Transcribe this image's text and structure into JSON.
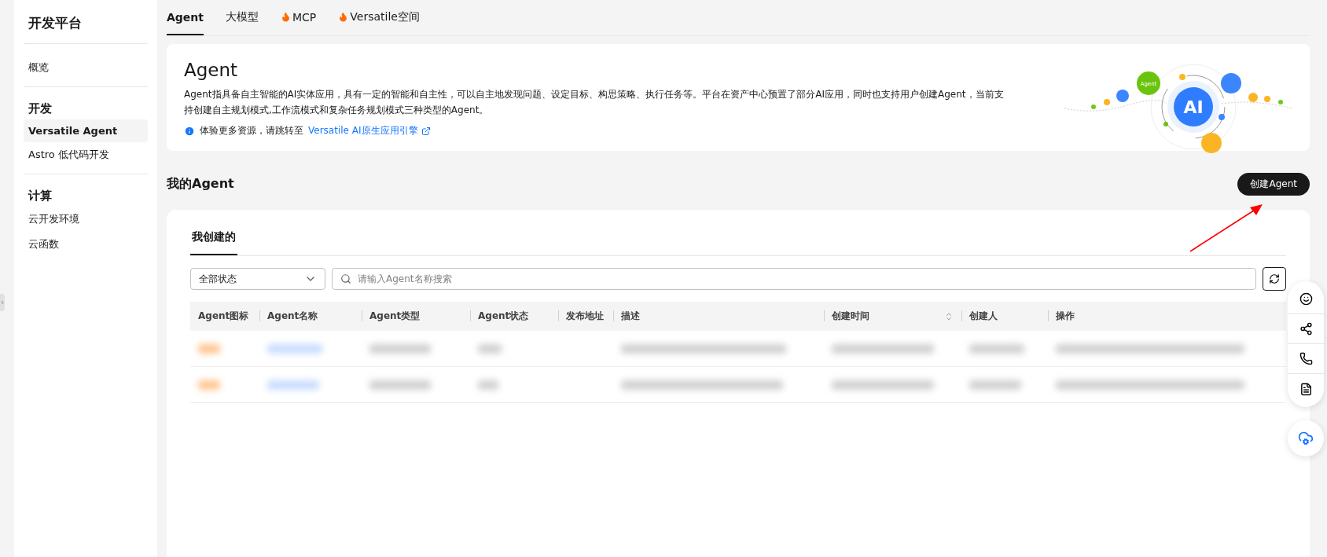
{
  "sidebar": {
    "title": "开发平台",
    "sections": [
      {
        "items": [
          {
            "label": "概览",
            "selected": false
          }
        ]
      },
      {
        "heading": "开发",
        "items": [
          {
            "label": "Versatile Agent",
            "selected": true
          },
          {
            "label": "Astro 低代码开发",
            "selected": false
          }
        ]
      },
      {
        "heading": "计算",
        "items": [
          {
            "label": "云开发环境",
            "selected": false
          },
          {
            "label": "云函数",
            "selected": false
          }
        ]
      }
    ]
  },
  "tabs": [
    {
      "label": "Agent",
      "selected": true,
      "hot": false
    },
    {
      "label": "大模型",
      "selected": false,
      "hot": false
    },
    {
      "label": "MCP",
      "selected": false,
      "hot": true
    },
    {
      "label": "Versatile空间",
      "selected": false,
      "hot": true
    }
  ],
  "intro": {
    "title": "Agent",
    "description": "Agent指具备自主智能的AI实体应用，具有一定的智能和自主性，可以自主地发现问题、设定目标、构思策略、执行任务等。平台在资产中心预置了部分AI应用，同时也支持用户创建Agent，当前支持创建自主规划模式,工作流模式和复杂任务规划模式三种类型的Agent。",
    "tip": "体验更多资源，请跳转至",
    "link": "Versatile AI原生应用引擎",
    "badge": "Agent",
    "logo": "AI"
  },
  "section": {
    "title": "我的Agent",
    "create_button": "创建Agent"
  },
  "subtabs": [
    {
      "label": "我创建的",
      "selected": true
    }
  ],
  "filter": {
    "status": "全部状态",
    "search_placeholder": "请输入Agent名称搜索"
  },
  "table": {
    "columns": [
      {
        "label": "Agent图标",
        "sortable": false
      },
      {
        "label": "Agent名称",
        "sortable": false
      },
      {
        "label": "Agent类型",
        "sortable": false
      },
      {
        "label": "Agent状态",
        "sortable": false
      },
      {
        "label": "发布地址",
        "sortable": false
      },
      {
        "label": "描述",
        "sortable": false
      },
      {
        "label": "创建时间",
        "sortable": true
      },
      {
        "label": "创建人",
        "sortable": false
      },
      {
        "label": "操作",
        "sortable": false
      }
    ],
    "rows": [
      {
        "redacted": true
      },
      {
        "redacted": true
      }
    ]
  },
  "annotation": {
    "kind": "arrow"
  }
}
